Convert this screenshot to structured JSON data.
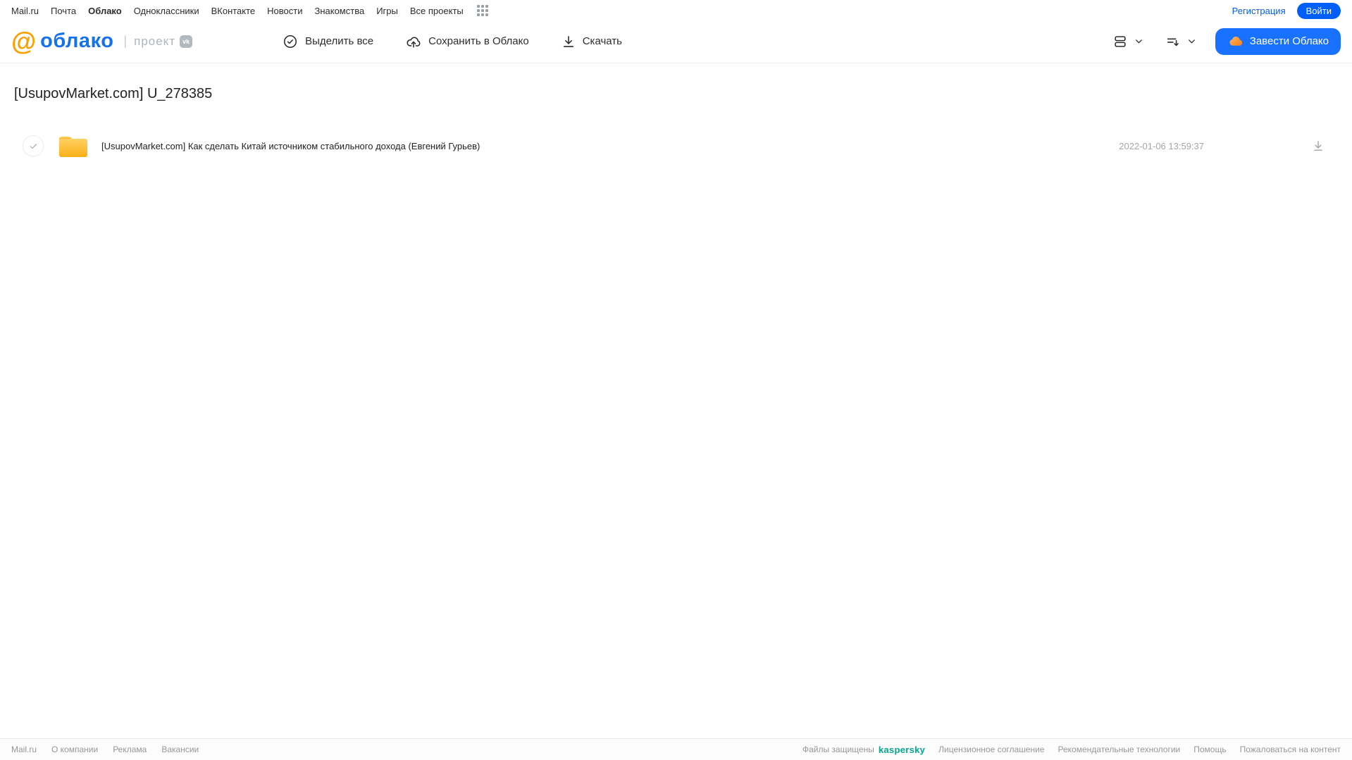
{
  "topbar": {
    "links": [
      {
        "label": "Mail.ru",
        "active": false
      },
      {
        "label": "Почта",
        "active": false
      },
      {
        "label": "Облако",
        "active": true
      },
      {
        "label": "Одноклассники",
        "active": false
      },
      {
        "label": "ВКонтакте",
        "active": false
      },
      {
        "label": "Новости",
        "active": false
      },
      {
        "label": "Знакомства",
        "active": false
      },
      {
        "label": "Игры",
        "active": false
      },
      {
        "label": "Все проекты",
        "active": false
      }
    ],
    "register_label": "Регистрация",
    "login_label": "Войти"
  },
  "header": {
    "logo_at": "@",
    "logo_text": "облако",
    "project_label": "проект",
    "vk_badge": "vk",
    "toolbar": {
      "select_all": "Выделить все",
      "save_to_cloud": "Сохранить в Облако",
      "download": "Скачать"
    },
    "create_cloud_label": "Завести Облако"
  },
  "page": {
    "title": "[UsupovMarket.com] U_278385"
  },
  "files": [
    {
      "type": "folder",
      "name": "[UsupovMarket.com] Как сделать Китай источником стабильного дохода (Евгений Гурьев)",
      "modified": "2022-01-06 13:59:37"
    }
  ],
  "footer": {
    "left_links": [
      {
        "label": "Mail.ru"
      },
      {
        "label": "О компании"
      },
      {
        "label": "Реклама"
      },
      {
        "label": "Вакансии"
      }
    ],
    "protected_label": "Файлы защищены",
    "kaspersky_label": "kaspersky",
    "right_links": [
      {
        "label": "Лицензионное соглашение"
      },
      {
        "label": "Рекомендательные технологии"
      },
      {
        "label": "Помощь"
      },
      {
        "label": "Пожаловаться на контент"
      }
    ]
  },
  "colors": {
    "accent_blue": "#005ff9",
    "button_blue": "#1971ff",
    "logo_orange": "#ff9e00",
    "logo_blue": "#1672ec",
    "kaspersky_teal": "#00a88e",
    "folder_top": "#ffd163",
    "folder_bottom": "#fbaf17"
  }
}
